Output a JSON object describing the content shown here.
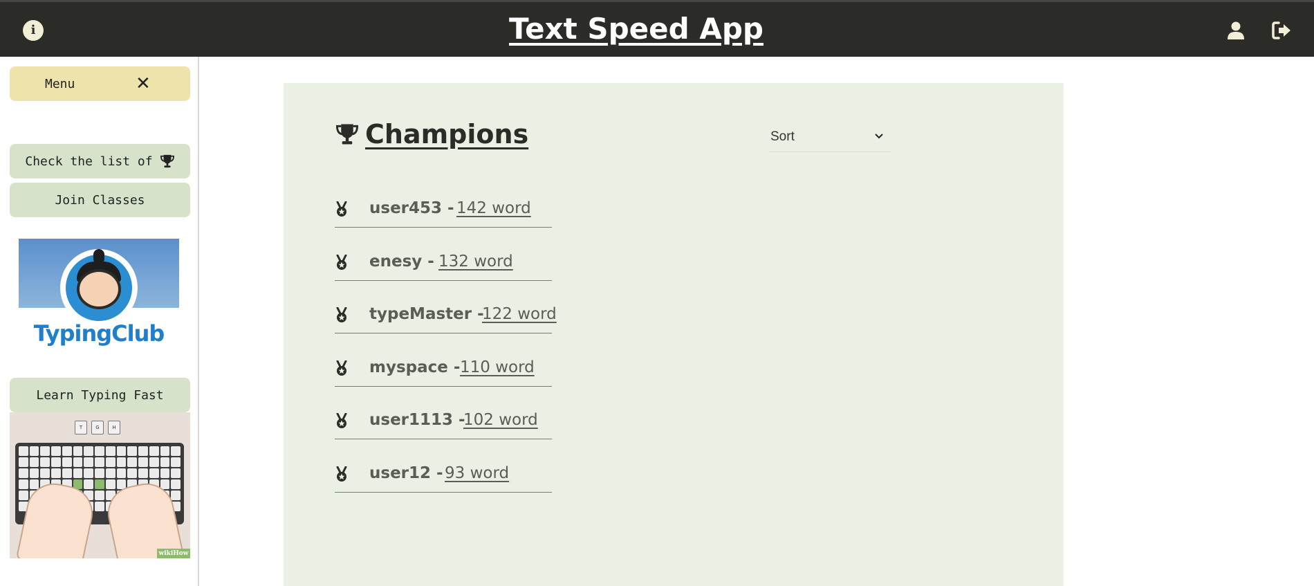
{
  "header": {
    "title": "Text Speed App",
    "info_icon": "info-icon",
    "user_icon": "user-icon",
    "logout_icon": "sign-out-icon",
    "background_color": "#2b2b27"
  },
  "sidebar": {
    "menu_label": "Menu",
    "close_icon": "close-icon",
    "champions_link": "Check the list of",
    "classes_link": "Join Classes",
    "ad_title": "TypingClub",
    "learn_label": "Learn Typing Fast",
    "kb_keys": [
      "T",
      "G",
      "H"
    ],
    "kb_badge": "wikiHow",
    "menu_color": "#ede3ab",
    "link_color": "#d6e3ca"
  },
  "main": {
    "title": "Champions",
    "trophy_icon": "trophy-icon",
    "sort_label": "Sort",
    "panel_color": "#ebf0e4",
    "champions": [
      {
        "name": "user453 -",
        "score": "142 word"
      },
      {
        "name": "enesy -",
        "score": "132 word"
      },
      {
        "name": "typeMaster -",
        "score": "122 word"
      },
      {
        "name": "myspace -",
        "score": "110 word"
      },
      {
        "name": "user1113 -",
        "score": "102 word"
      },
      {
        "name": "user12 -",
        "score": "93 word"
      }
    ]
  }
}
